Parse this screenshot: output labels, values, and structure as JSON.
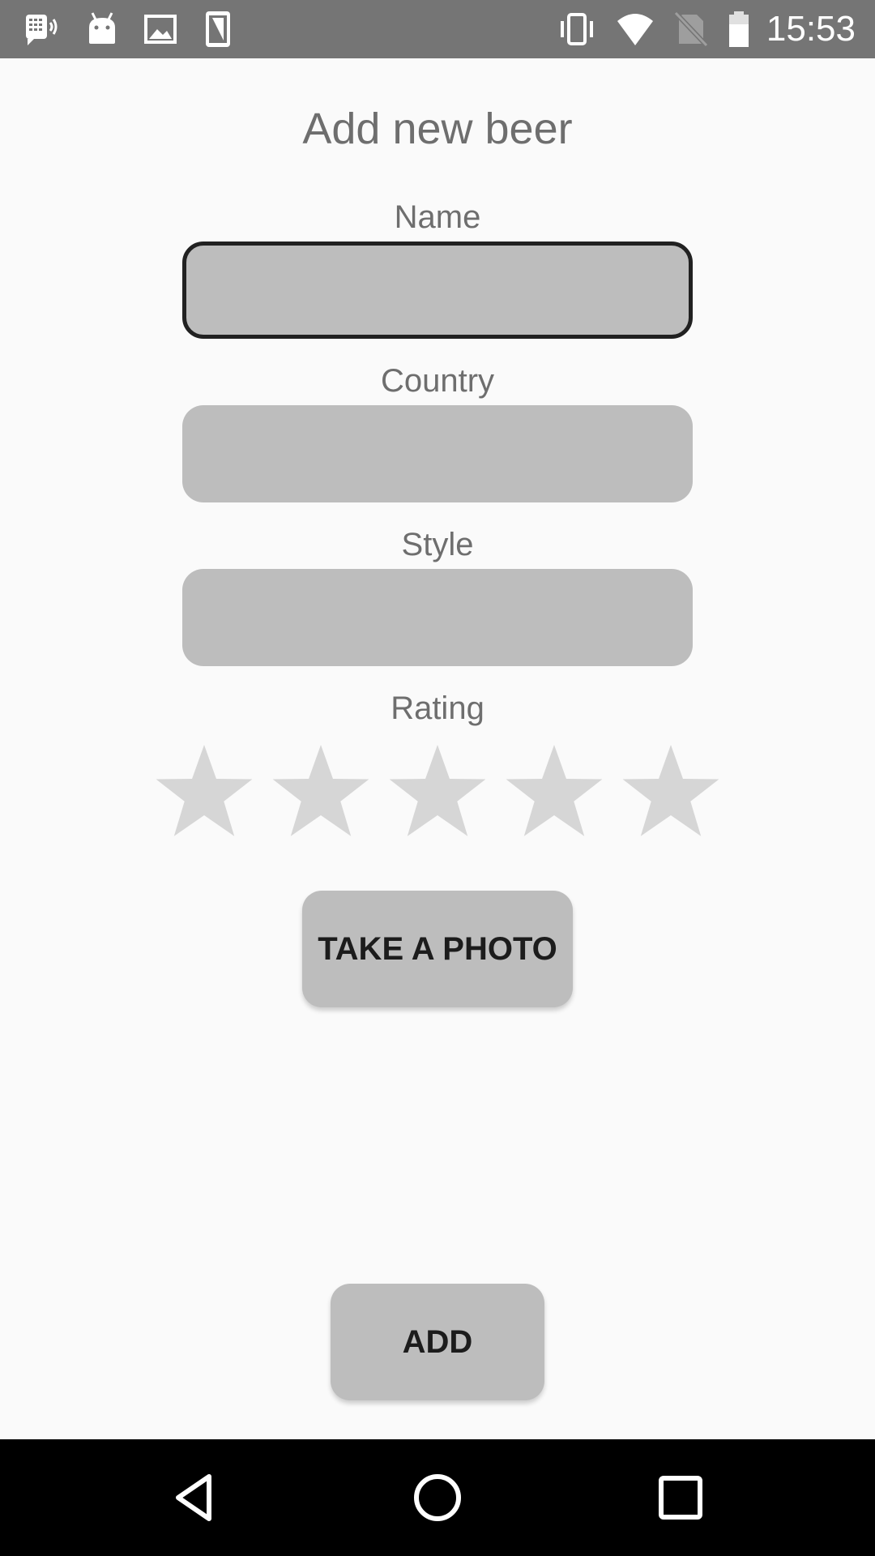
{
  "status_bar": {
    "time": "15:53",
    "icons": [
      "voicemail-icon",
      "android-icon",
      "image-icon",
      "screen-rotation-icon",
      "vibrate-icon",
      "wifi-icon",
      "no-sim-icon",
      "battery-icon"
    ]
  },
  "form": {
    "title": "Add new beer",
    "name_label": "Name",
    "country_label": "Country",
    "style_label": "Style",
    "rating_label": "Rating",
    "name_value": "",
    "country_value": "",
    "style_value": "",
    "rating": {
      "value": 0,
      "max": 5
    },
    "take_photo_label": "TAKE A PHOTO",
    "add_label": "ADD"
  },
  "colors": {
    "status_bar": "#757575",
    "input_fill": "#bdbdbd",
    "star_empty": "#d6d6d6",
    "label_text": "#6e6e6e",
    "nav_bar": "#000000"
  },
  "nav_bar": {
    "icons": [
      "back-icon",
      "home-icon",
      "recents-icon"
    ]
  }
}
